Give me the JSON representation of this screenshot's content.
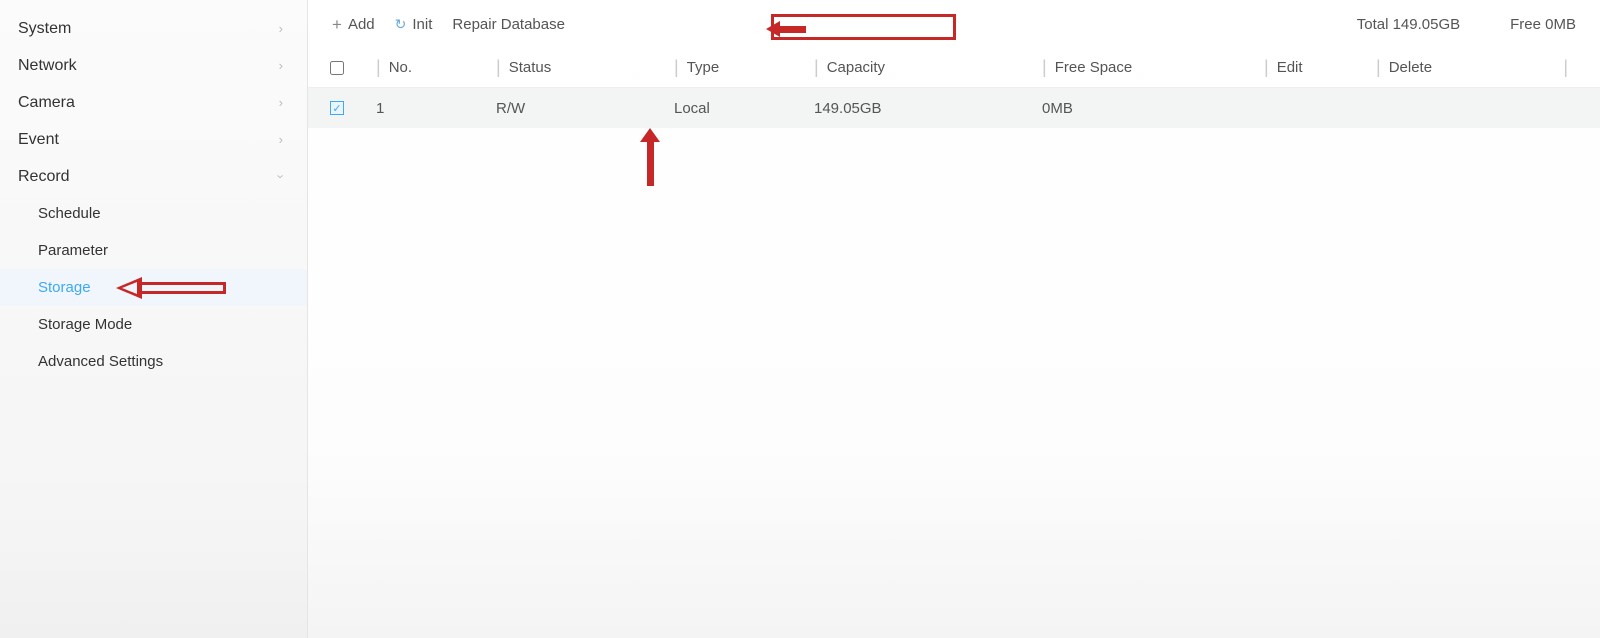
{
  "sidebar": {
    "items": [
      {
        "label": "System",
        "expandable": true,
        "expanded": false
      },
      {
        "label": "Network",
        "expandable": true,
        "expanded": false
      },
      {
        "label": "Camera",
        "expandable": true,
        "expanded": false
      },
      {
        "label": "Event",
        "expandable": true,
        "expanded": false
      },
      {
        "label": "Record",
        "expandable": true,
        "expanded": true
      }
    ],
    "record_children": [
      {
        "label": "Schedule",
        "active": false
      },
      {
        "label": "Parameter",
        "active": false
      },
      {
        "label": "Storage",
        "active": true
      },
      {
        "label": "Storage Mode",
        "active": false
      },
      {
        "label": "Advanced Settings",
        "active": false
      }
    ]
  },
  "toolbar": {
    "add_label": "Add",
    "init_label": "Init",
    "repair_label": "Repair Database",
    "total_label": "Total 149.05GB",
    "free_label": "Free 0MB"
  },
  "table": {
    "headers": {
      "no": "No.",
      "status": "Status",
      "type": "Type",
      "capacity": "Capacity",
      "free": "Free Space",
      "edit": "Edit",
      "delete": "Delete"
    },
    "rows": [
      {
        "checked": true,
        "no": "1",
        "status": "R/W",
        "type": "Local",
        "capacity": "149.05GB",
        "free": "0MB"
      }
    ]
  },
  "annotations": {
    "arrow_left_to_init": true,
    "box_around_repair": true,
    "arrow_up_to_row_checkbox": true,
    "arrow_to_storage_menu": true
  }
}
